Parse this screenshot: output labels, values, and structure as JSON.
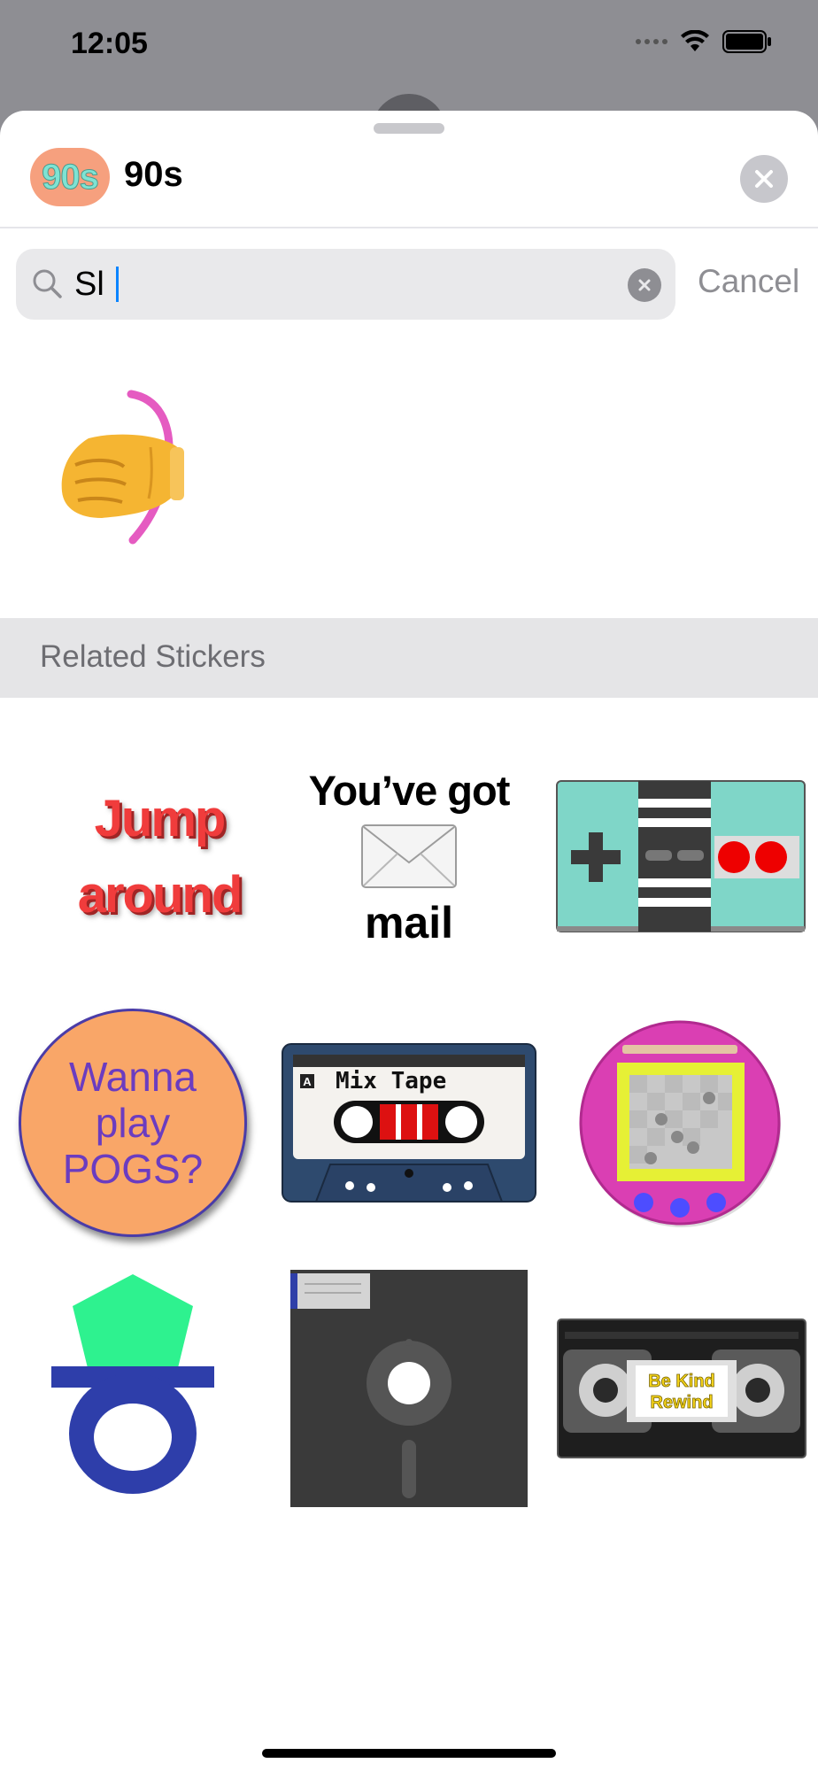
{
  "status_bar": {
    "time": "12:05"
  },
  "sheet": {
    "pack_logo_text": "90s",
    "title": "90s",
    "close_icon": "close-icon"
  },
  "search": {
    "value": "Sl",
    "clear_icon": "clear-icon",
    "cancel_label": "Cancel"
  },
  "results": [
    {
      "name": "fist-swinging-emoji-sticker",
      "icon": "punch-emoji"
    }
  ],
  "related": {
    "section_title": "Related Stickers",
    "stickers": [
      {
        "name": "jump-around-sticker",
        "lines": [
          "Jump",
          "around"
        ]
      },
      {
        "name": "youve-got-mail-sticker",
        "line1": "You’ve got",
        "line2": "mail"
      },
      {
        "name": "game-controller-sticker"
      },
      {
        "name": "pogs-sticker",
        "lines": [
          "Wanna",
          "play",
          "POGS?"
        ]
      },
      {
        "name": "mix-tape-sticker",
        "label": "Mix Tape",
        "side": "A"
      },
      {
        "name": "virtual-pet-sticker"
      },
      {
        "name": "ring-pop-sticker"
      },
      {
        "name": "floppy-disk-sticker"
      },
      {
        "name": "vhs-tape-sticker",
        "label_lines": [
          "Be Kind",
          "Rewind"
        ]
      }
    ]
  },
  "colors": {
    "background_dim": "#8e8e93",
    "sheet": "#ffffff",
    "search_field": "#e9e9eb",
    "section_header": "#e5e5e7",
    "accent": "#0a84ff"
  }
}
